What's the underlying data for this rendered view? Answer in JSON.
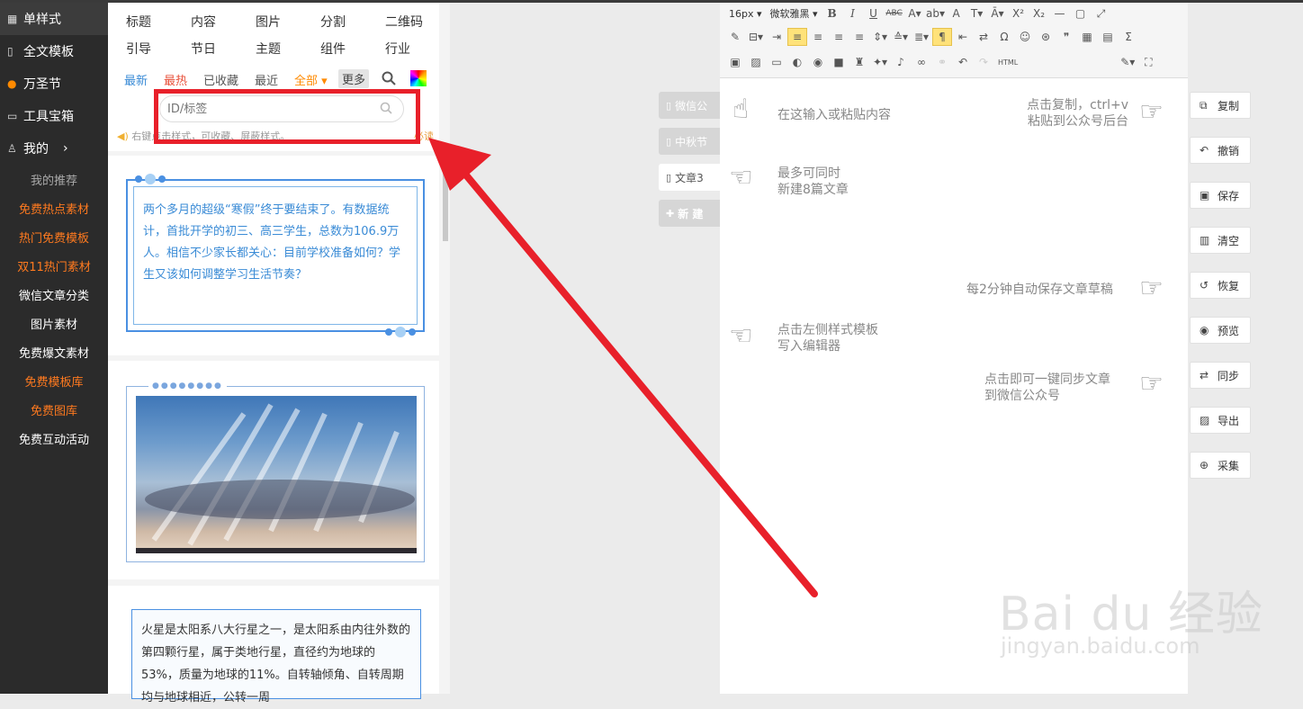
{
  "sidebar": {
    "main": [
      {
        "icon": "grid-icon",
        "glyph": "▦",
        "label": "单样式"
      },
      {
        "icon": "template-icon",
        "glyph": "▯",
        "label": "全文模板"
      },
      {
        "icon": "pumpkin-icon",
        "glyph": "●",
        "label": "万圣节"
      },
      {
        "icon": "toolbox-icon",
        "glyph": "▭",
        "label": "工具宝箱"
      },
      {
        "icon": "user-icon",
        "glyph": "♙",
        "label": "我的"
      }
    ],
    "sub": [
      {
        "label": "我的推荐"
      },
      {
        "label": "免费热点素材"
      },
      {
        "label": "热门免费模板"
      },
      {
        "label": "双11热门素材"
      },
      {
        "label": "微信文章分类"
      },
      {
        "label": "图片素材"
      },
      {
        "label": "免费爆文素材"
      },
      {
        "label": "免费模板库"
      },
      {
        "label": "免费图库"
      },
      {
        "label": "免费互动活动"
      }
    ]
  },
  "categories": [
    "标题",
    "内容",
    "图片",
    "分割",
    "二维码",
    "引导",
    "节日",
    "主题",
    "组件",
    "行业"
  ],
  "filters": [
    "最新",
    "最热",
    "已收藏",
    "最近",
    "全部 ▾",
    "更多"
  ],
  "search": {
    "placeholder": "ID/标签"
  },
  "hint": "右键点击样式，可收藏、屏蔽样式。",
  "hint_right": "必读",
  "cards": {
    "card1_text": "两个多月的超级“寒假”终于要结束了。有数据统计，首批开学的初三、高三学生，总数为106.9万人。相信不少家长都关心：目前学校准备如何？学生又该如何调整学习生活节奏？",
    "card2_dots": "●●●●●●●●",
    "card3_text": "火星是太阳系八大行星之一，是太阳系由内往外数的第四颗行星，属于类地行星，直径约为地球的53%，质量为地球的11%。自转轴倾角、自转周期均与地球相近，公转一周"
  },
  "doc_tabs": [
    "微信公",
    "中秋节",
    "文章3",
    "新 建"
  ],
  "toolbar": {
    "font_size": "16px ▾",
    "font_family": "微软雅黑 ▾",
    "html_label": "HTML",
    "row1": [
      "B",
      "I",
      "U",
      "ABC",
      "A▾",
      "ab▾",
      "A",
      "T▾",
      "Ā▾",
      "X²",
      "X₂",
      "—",
      "▢",
      "⤢"
    ],
    "row2": [
      "✎",
      "⊟▾",
      "⇥",
      "≡",
      "≡",
      "≡",
      "≡",
      "⇕▾",
      "≙▾",
      "≣▾",
      "¶",
      "⇤",
      "⇄",
      "Ω",
      "☺",
      "⊛",
      "❞",
      "▦",
      "▤",
      "Σ"
    ],
    "row3": [
      "▣",
      "▨",
      "▭",
      "◐",
      "◉",
      "■",
      "♜",
      "✦▾",
      "♪",
      "∞",
      "⚭",
      "↶",
      "↷"
    ]
  },
  "tips": {
    "input": "在这输入或粘贴内容",
    "max_line1": "最多可同时",
    "max_line2": "新建8篇文章",
    "copy_line1": "点击复制，ctrl+v",
    "copy_line2": "粘贴到公众号后台",
    "autosave": "每2分钟自动保存文章草稿",
    "template_line1": "点击左侧样式模板",
    "template_line2": "写入编辑器",
    "sync_line1": "点击即可一键同步文章",
    "sync_line2": "到微信公众号"
  },
  "right_buttons": [
    {
      "icon": "copy-icon",
      "glyph": "⧉",
      "label": "复制"
    },
    {
      "icon": "undo-icon",
      "glyph": "↶",
      "label": "撤销"
    },
    {
      "icon": "save-icon",
      "glyph": "▣",
      "label": "保存"
    },
    {
      "icon": "trash-icon",
      "glyph": "▥",
      "label": "清空"
    },
    {
      "icon": "restore-icon",
      "glyph": "↺",
      "label": "恢复"
    },
    {
      "icon": "eye-icon",
      "glyph": "◉",
      "label": "预览"
    },
    {
      "icon": "sync-icon",
      "glyph": "⇄",
      "label": "同步"
    },
    {
      "icon": "export-icon",
      "glyph": "▨",
      "label": "导出"
    },
    {
      "icon": "collect-icon",
      "glyph": "⊕",
      "label": "采集"
    }
  ],
  "watermark": {
    "line1": "Bai du 经验",
    "line2": "jingyan.baidu.com"
  },
  "colors": {
    "accent_red": "#e8202a",
    "sidebar_bg": "#2b2b2b",
    "orange": "#ff7a1f",
    "blue": "#3a8bd6"
  }
}
